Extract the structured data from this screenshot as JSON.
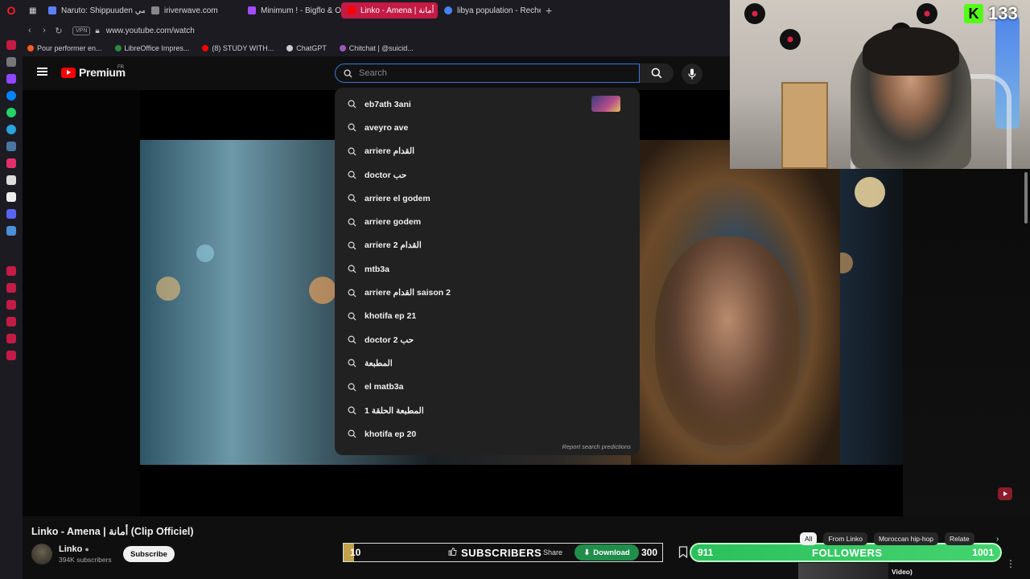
{
  "browser": {
    "tabs": [
      {
        "label": "Naruto: Shippuuden انمي",
        "color": "#5b7fff"
      },
      {
        "label": "iriverwave.com",
        "color": "#888888"
      },
      {
        "label": "Minimum ! - Bigflo & Oli -",
        "color": "#a44cff"
      },
      {
        "label": "Linko - Amena | أمانة",
        "color": "#ff0000",
        "active": true
      },
      {
        "label": "libya population - Recherc",
        "color": "#4285f4"
      }
    ],
    "new_tab": "+",
    "vpn": "VPN",
    "url": "www.youtube.com/watch",
    "bookmarks": [
      {
        "label": "Pour performer en...",
        "color": "#ff5a1f"
      },
      {
        "label": "LibreOffice Impres...",
        "color": "#2b8a3e"
      },
      {
        "label": "(8) STUDY WITH...",
        "color": "#ff0000"
      },
      {
        "label": "ChatGPT",
        "color": "#cccccc"
      },
      {
        "label": "Chitchat | @suicid...",
        "color": "#9b59b6"
      }
    ]
  },
  "youtube": {
    "brand": "Premium",
    "region": "FR",
    "search_placeholder": "Search",
    "suggestions": [
      "eb7ath 3ani",
      "aveyro ave",
      "arriere القدام",
      "doctor حب",
      "arriere el godem",
      "arriere godem",
      "arriere 2 القدام",
      "mtb3a",
      "arriere القدام saison 2",
      "khotifa ep 21",
      "doctor 2 حب",
      "المطبعة",
      "el matb3a",
      "المطبعة الحلقة 1",
      "khotifa ep 20"
    ],
    "report_link": "Report search predictions",
    "video_title": "Linko - Amena | أمانة (Clip Officiel)",
    "channel_name": "Linko",
    "channel_subs": "394K subscribers",
    "subscribe_label": "Subscribe",
    "share_label": "Share",
    "download_label": "Download",
    "chips": [
      "All",
      "From Linko",
      "Moroccan hip-hop",
      "Relate"
    ],
    "related_title": "Video)"
  },
  "overlays": {
    "kick_count": "133",
    "subscriber_goal": {
      "current": "10",
      "label": "SUBSCRIBERS",
      "target": "300",
      "progress": 0.033
    },
    "followers_goal": {
      "current": "911",
      "label": "FOLLOWERS",
      "target": "1001",
      "progress": 0.91
    }
  },
  "colors": {
    "accent": "#3a78d6",
    "youtube_red": "#ff0000",
    "kick_green": "#53fc18",
    "download_green": "#1f8e4a"
  }
}
